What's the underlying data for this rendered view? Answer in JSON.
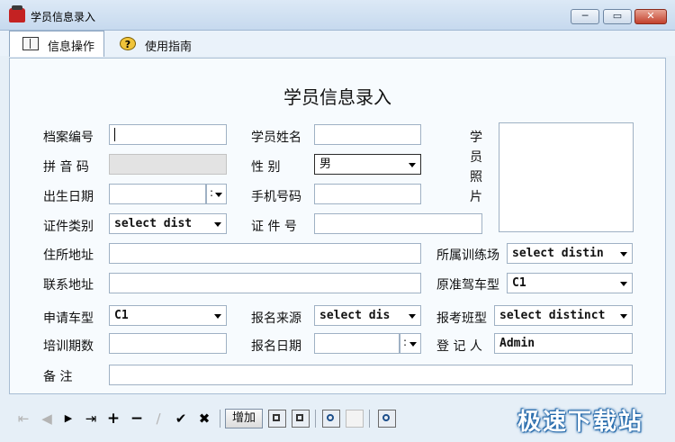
{
  "window": {
    "title": "学员信息录入",
    "min_label": "─",
    "max_label": "▭",
    "close_label": "✕"
  },
  "tabs": [
    {
      "label": "信息操作",
      "icon": "book-icon"
    },
    {
      "label": "使用指南",
      "icon": "help-icon",
      "icon_text": "?"
    }
  ],
  "form": {
    "title": "学员信息录入",
    "labels": {
      "archive_no": "档案编号",
      "student_name": "学员姓名",
      "pinyin": "拼  音  码",
      "gender": "性      别",
      "birth_date": "出生日期",
      "phone": "手机号码",
      "id_type": "证件类别",
      "id_no": "证  件  号",
      "address": "住所地址",
      "contact_address": "联系地址",
      "training_school": "所属训练场",
      "original_license": "原准驾车型",
      "apply_type": "申请车型",
      "source": "报名来源",
      "class_type": "报考班型",
      "training_period": "培训期数",
      "signup_date": "报名日期",
      "registrar": "登  记  人",
      "remarks": "备        注",
      "photo": "学员照片"
    },
    "values": {
      "gender": "男",
      "id_type": "select dist",
      "training_school": "select distin",
      "original_license": "C1",
      "apply_type": "C1",
      "source": "select dis",
      "class_type": "select distinct",
      "registrar": "Admin",
      "date_colon": ":"
    }
  },
  "toolbar": {
    "first": "⇤",
    "prev": "◀",
    "next": "▶",
    "last": "⇥",
    "add": "+",
    "delete": "−",
    "edit": "∕",
    "confirm": "✔",
    "cancel": "✖",
    "increase_label": "增加"
  },
  "watermark": "极速下载站"
}
